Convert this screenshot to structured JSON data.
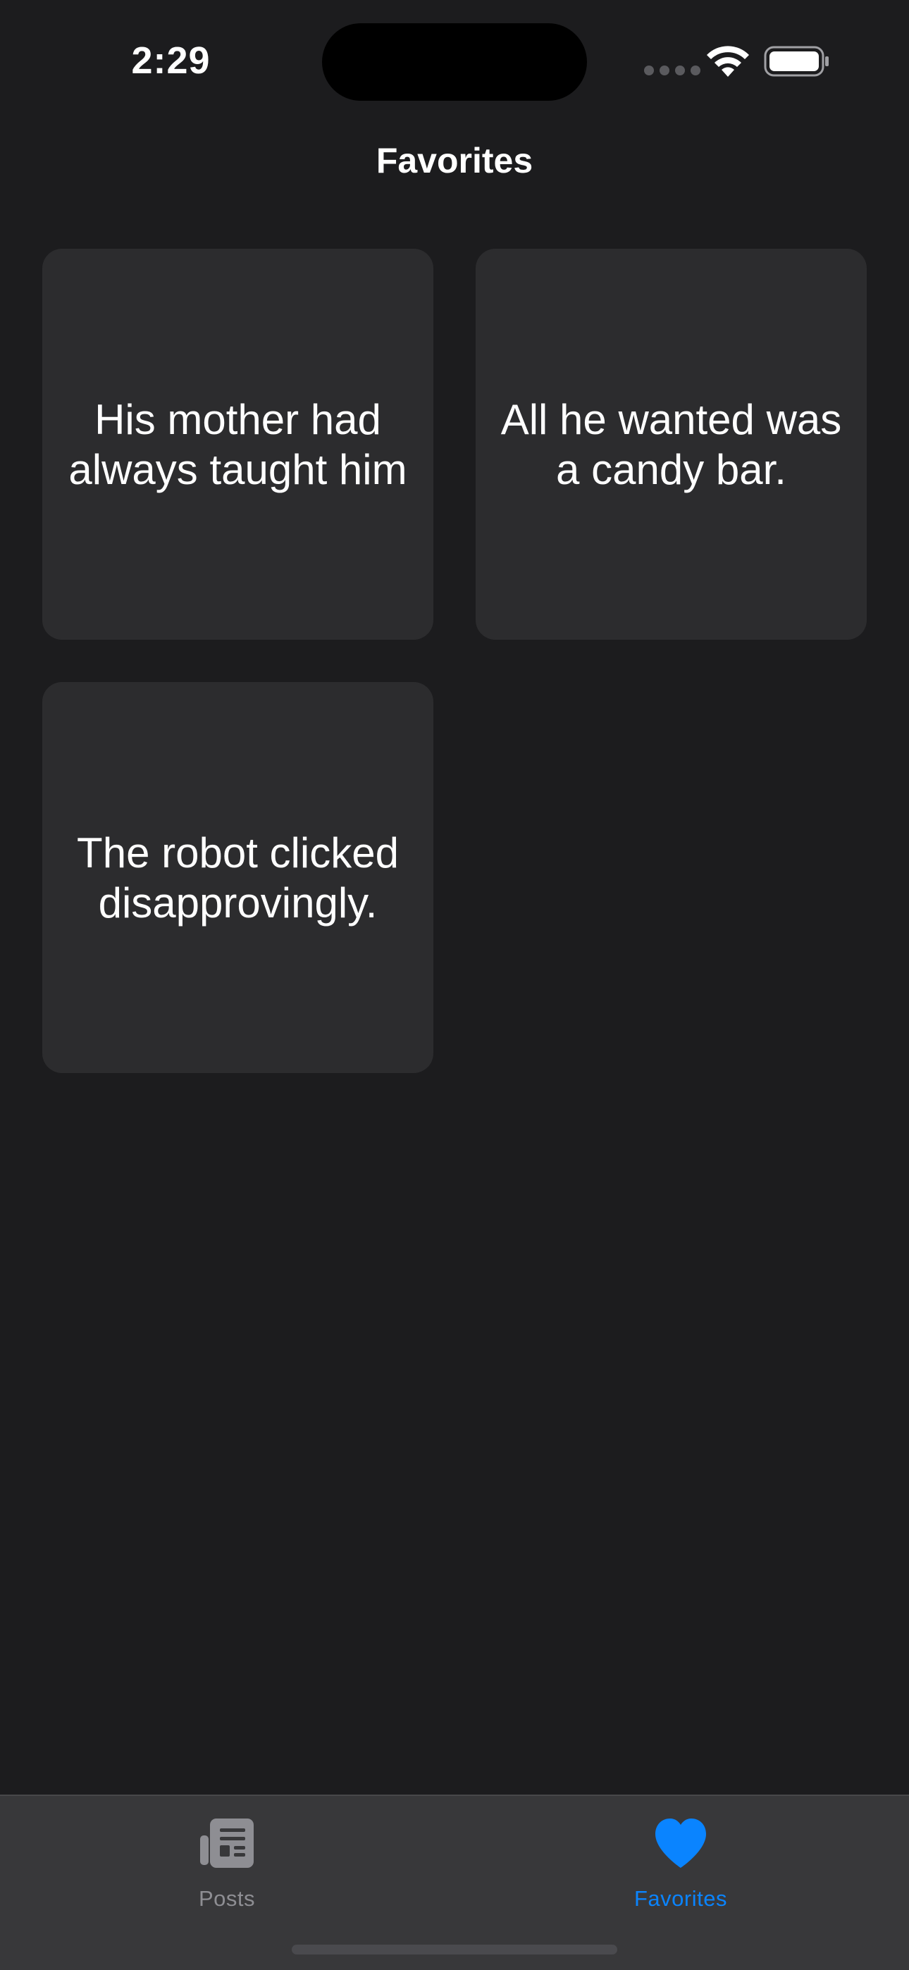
{
  "status_bar": {
    "time": "2:29"
  },
  "nav": {
    "title": "Favorites"
  },
  "favorites": [
    {
      "text": "His mother had always taught him"
    },
    {
      "text": "All he wanted was a candy bar."
    },
    {
      "text": "The robot clicked disapprovingly."
    }
  ],
  "tab_bar": {
    "tabs": [
      {
        "label": "Posts",
        "icon": "newspaper-icon",
        "selected": false
      },
      {
        "label": "Favorites",
        "icon": "heart-icon",
        "selected": true
      }
    ]
  },
  "colors": {
    "background": "#1c1c1e",
    "card": "#2c2c2e",
    "tab_bar": "#38383a",
    "accent": "#0a84ff",
    "inactive": "#8e8e93"
  }
}
